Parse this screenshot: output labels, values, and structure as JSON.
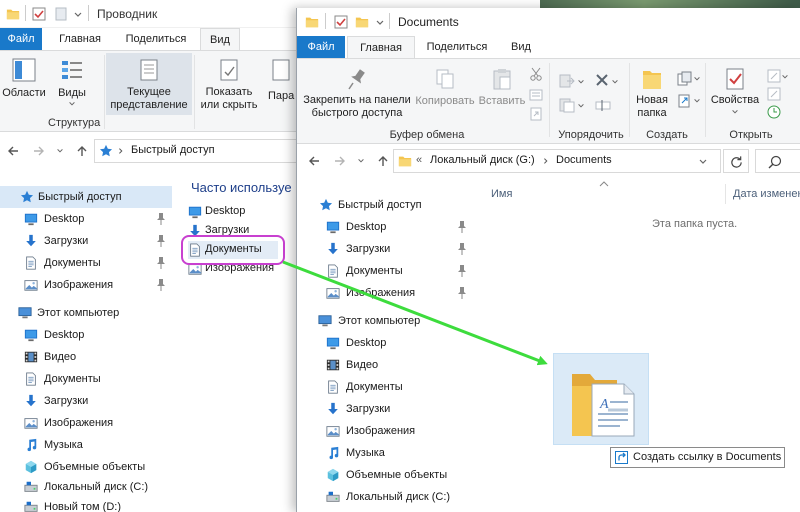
{
  "back_window": {
    "title": "Проводник",
    "tabs": {
      "file": "Файл",
      "home": "Главная",
      "share": "Поделиться",
      "view": "Вид"
    },
    "ribbon": {
      "areas": "Области",
      "views": "Виды",
      "current_view": "Текущее\nпредставление",
      "show_hide": "Показать\nили скрыть",
      "params": "Пара",
      "structure_group": "Структура"
    },
    "address": {
      "path": "Быстрый доступ"
    },
    "frequent_heading": "Часто используе",
    "frequent_items": [
      "Desktop",
      "Загрузки",
      "Документы",
      "Изображения"
    ],
    "nav": {
      "quick_access": "Быстрый доступ",
      "quick_items": [
        "Desktop",
        "Загрузки",
        "Документы",
        "Изображения"
      ],
      "this_pc": "Этот компьютер",
      "pc_items": [
        "Desktop",
        "Видео",
        "Документы",
        "Загрузки",
        "Изображения",
        "Музыка",
        "Объемные объекты",
        "Локальный диск (C:)",
        "Новый том (D:)"
      ]
    }
  },
  "front_window": {
    "title": "Documents",
    "tabs": {
      "file": "Файл",
      "home": "Главная",
      "share": "Поделиться",
      "view": "Вид"
    },
    "ribbon": {
      "pin": "Закрепить на панели\nбыстрого доступа",
      "copy": "Копировать",
      "paste": "Вставить",
      "clipboard_group": "Буфер обмена",
      "organize_group": "Упорядочить",
      "new_folder": "Новая\nпапка",
      "create_group": "Создать",
      "properties": "Свойства",
      "open_group": "Открыть"
    },
    "address": {
      "prefix": "«",
      "drive": "Локальный диск (G:)",
      "folder": "Documents"
    },
    "columns": {
      "name": "Имя",
      "date": "Дата изменен"
    },
    "empty_message": "Эта папка пуста.",
    "nav": {
      "quick_access": "Быстрый доступ",
      "quick_items": [
        "Desktop",
        "Загрузки",
        "Документы",
        "Изображения"
      ],
      "this_pc": "Этот компьютер",
      "pc_items": [
        "Desktop",
        "Видео",
        "Документы",
        "Загрузки",
        "Изображения",
        "Музыка",
        "Объемные объекты",
        "Локальный диск (C:)"
      ]
    }
  },
  "drag_tooltip": "Создать ссылку в Documents",
  "colors": {
    "file_tab": "#1979ca",
    "highlight_ring": "#c840d0",
    "arrow": "#3ddc3d",
    "folder": "#f4c550",
    "link_arrow": "#1979ca"
  }
}
